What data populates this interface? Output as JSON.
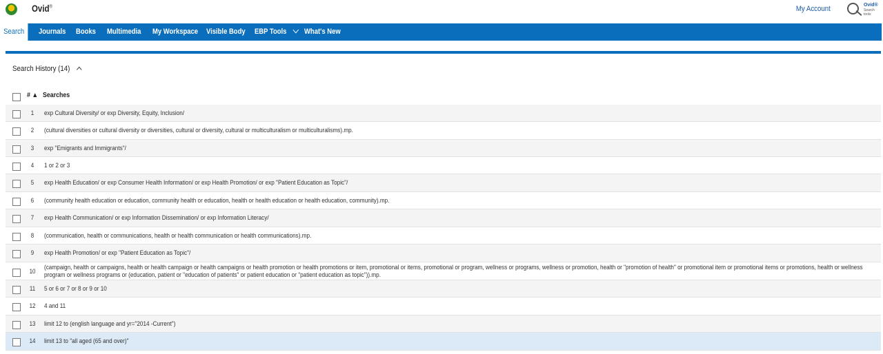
{
  "header": {
    "brand": "Ovid",
    "brand_mark": "®",
    "my_account": "My Account",
    "logo_text": "Ovid®",
    "logo_subtext": "Search tools"
  },
  "nav": {
    "items": [
      "Search",
      "Journals",
      "Books",
      "Multimedia",
      "My Workspace",
      "Visible Body",
      "EBP Tools",
      "What's New"
    ],
    "active": "Search"
  },
  "history": {
    "title": "Search History (14)",
    "col_number": "# ▲",
    "col_searches": "Searches",
    "rows": [
      {
        "n": "1",
        "q": "exp Cultural Diversity/ or exp Diversity, Equity, Inclusion/"
      },
      {
        "n": "2",
        "q": "(cultural diversities or cultural diversity or diversities, cultural or diversity, cultural or multiculturalism or multiculturalisms).mp."
      },
      {
        "n": "3",
        "q": "exp \"Emigrants and Immigrants\"/"
      },
      {
        "n": "4",
        "q": "1 or 2 or 3"
      },
      {
        "n": "5",
        "q": "exp Health Education/ or exp Consumer Health Information/ or exp Health Promotion/ or exp \"Patient Education as Topic\"/"
      },
      {
        "n": "6",
        "q": "(community health education or education, community health or education, health or health education or health education, community).mp."
      },
      {
        "n": "7",
        "q": "exp Health Communication/ or exp Information Dissemination/ or exp Information Literacy/"
      },
      {
        "n": "8",
        "q": "(communication, health or communications, health or health communication or health communications).mp."
      },
      {
        "n": "9",
        "q": "exp Health Promotion/ or exp \"Patient Education as Topic\"/"
      },
      {
        "n": "10",
        "q": "(campaign, health or campaigns, health or health campaign or health campaigns or health promotion or health promotions or item, promotional or items, promotional or program, wellness or programs, wellness or promotion, health or \"promotion of health\" or promotional item or promotional items or promotions, health or wellness program or wellness programs or (education, patient or \"education of patients\" or patient education or \"patient education as topic\")).mp."
      },
      {
        "n": "11",
        "q": "5 or 6 or 7 or 8 or 9 or 10"
      },
      {
        "n": "12",
        "q": "4 and 11"
      },
      {
        "n": "13",
        "q": "limit 12 to (english language and yr=\"2014 -Current\")"
      },
      {
        "n": "14",
        "q": "limit 13 to \"all aged (65 and over)\""
      }
    ]
  }
}
